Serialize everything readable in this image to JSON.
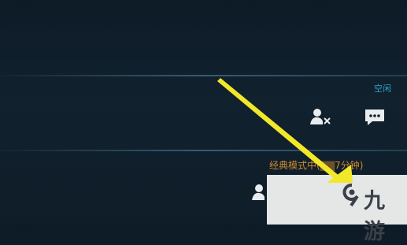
{
  "friend_row": {
    "status": "空闲"
  },
  "second_row": {
    "mode_status": "经典模式中(",
    "mode_status_tail": "7分钟)"
  },
  "watermark": {
    "text": "九游"
  },
  "icons": {
    "remove_friend": "user-remove-icon",
    "chat": "chat-bubble-icon",
    "user": "user-icon",
    "logo": "9game-logo-icon"
  },
  "colors": {
    "status": "#2ea2c9",
    "mode": "#d08a2c",
    "arrow": "#f2e82a"
  }
}
